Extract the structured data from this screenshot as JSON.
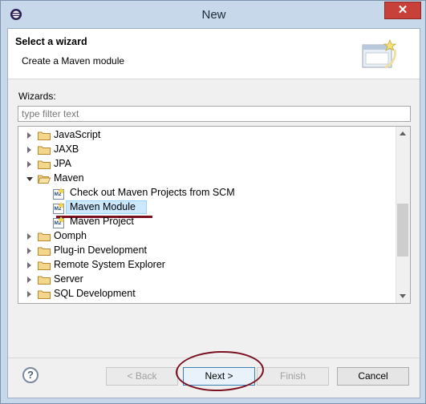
{
  "window": {
    "title": "New",
    "close_glyph": "✕",
    "icon": "eclipse-icon"
  },
  "header": {
    "title": "Select a wizard",
    "description": "Create a Maven module"
  },
  "filter": {
    "label": "Wizards:",
    "placeholder": "type filter text",
    "value": ""
  },
  "tree": {
    "items": [
      {
        "label": "JavaScript",
        "type": "folder",
        "expanded": false
      },
      {
        "label": "JAXB",
        "type": "folder",
        "expanded": false
      },
      {
        "label": "JPA",
        "type": "folder",
        "expanded": false
      },
      {
        "label": "Maven",
        "type": "folder",
        "expanded": true
      },
      {
        "label": "Check out Maven Projects from SCM",
        "type": "wizard"
      },
      {
        "label": "Maven Module",
        "type": "wizard",
        "selected": true
      },
      {
        "label": "Maven Project",
        "type": "wizard"
      },
      {
        "label": "Oomph",
        "type": "folder",
        "expanded": false
      },
      {
        "label": "Plug-in Development",
        "type": "folder",
        "expanded": false
      },
      {
        "label": "Remote System Explorer",
        "type": "folder",
        "expanded": false
      },
      {
        "label": "Server",
        "type": "folder",
        "expanded": false
      },
      {
        "label": "SQL Development",
        "type": "folder",
        "expanded": false
      }
    ]
  },
  "buttons": {
    "help": "?",
    "back": "< Back",
    "next": "Next >",
    "finish": "Finish",
    "cancel": "Cancel"
  },
  "colors": {
    "annotation": "#7a1020",
    "selection": "#cce8ff",
    "close_button": "#c7403a"
  }
}
